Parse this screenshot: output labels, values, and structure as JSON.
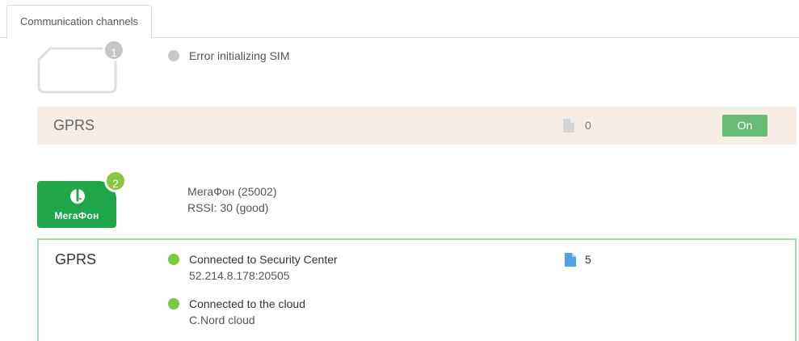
{
  "tabs": [
    {
      "label": "Communication channels"
    }
  ],
  "sim1": {
    "badge": "1",
    "status": "Error initializing SIM",
    "channel": {
      "label": "GPRS",
      "count": "0",
      "toggle_label": "On"
    }
  },
  "sim2": {
    "badge": "2",
    "logo_text": "МегаФон",
    "operator": "МегаФон (25002)",
    "rssi": "RSSI: 30 (good)",
    "channel": {
      "label": "GPRS",
      "count": "5",
      "connections": [
        {
          "title": "Connected to Security Center",
          "detail": "52.214.8.178:20505"
        },
        {
          "title": "Connected to the cloud",
          "detail": "C.Nord cloud"
        }
      ]
    }
  },
  "colors": {
    "status_gray": "#c8c8c8",
    "status_green": "#7ac943",
    "toggle_on": "#68bb74",
    "megafon_green": "#1fa64a",
    "file_active": "#4da3e8",
    "file_inactive": "#d4d4d4"
  }
}
